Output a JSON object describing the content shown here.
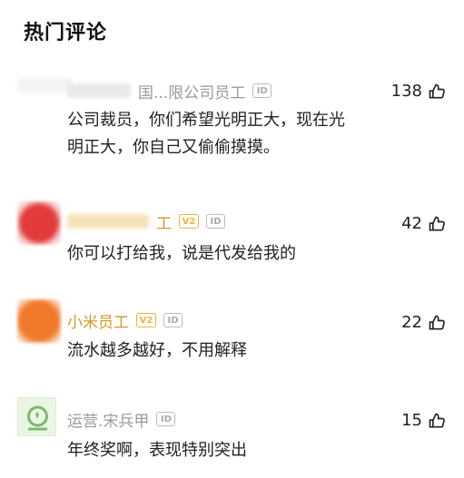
{
  "section_title": "热门评论",
  "comments": [
    {
      "username_suffix": "国...限公司员工",
      "id_badge": "ID",
      "likes": "138",
      "text_line1": "公司裁员，你们希望光明正大，现在光",
      "text_line2": "明正大，你自己又偷偷摸摸。"
    },
    {
      "username_suffix": "工",
      "vip_badge": "V2",
      "id_badge": "ID",
      "likes": "42",
      "text": "你可以打给我，说是代发给我的"
    },
    {
      "username": "小米员工",
      "vip_badge": "V2",
      "id_badge": "ID",
      "likes": "22",
      "text": "流水越多越好，不用解释"
    },
    {
      "username": "运营.宋兵甲",
      "id_badge": "ID",
      "likes": "15",
      "text": "年终奖啊，表现特别突出"
    }
  ],
  "colors": {
    "vip_gold": "#e8b73a",
    "username_gold": "#d19a2b",
    "gray_text": "#9b9b9b",
    "avatar_red": "#e33b3b",
    "avatar_orange": "#f07a2a",
    "avatar_green": "#eaf6e4"
  },
  "icons": {
    "like": "thumbs-up-icon"
  }
}
